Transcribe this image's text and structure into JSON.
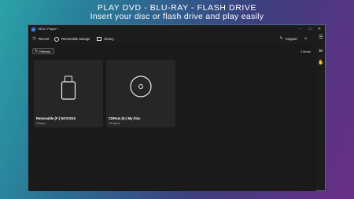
{
  "banner": {
    "title": "PLAY DVD - BLU-RAY - FLASH DRIVE",
    "subtitle": "Insert your disc or flash drive and play easily"
  },
  "window": {
    "title": "HEVC Player+",
    "controls": {
      "minimize": "–",
      "maximize": "□",
      "close": "✕"
    }
  },
  "nav": {
    "recent": "Recent",
    "removable": "Removable storage",
    "library": "Library",
    "support": "Support"
  },
  "toolbar": {
    "refresh": "Refresh",
    "item_count": "2 items"
  },
  "drives": [
    {
      "name": "Removable (F:) NOV2019",
      "items": "0 items",
      "icon": "usb-drive-icon"
    },
    {
      "name": "CDRom (E:) My Disc",
      "items": "15 items",
      "icon": "disc-icon"
    }
  ],
  "sidebar": {
    "icons": [
      "menu-icon",
      "linkedin-icon",
      "gesture-icon"
    ]
  },
  "colors": {
    "accent": "#3a78d6",
    "window_bg": "#1c1c1c",
    "card_bg": "#262626"
  }
}
